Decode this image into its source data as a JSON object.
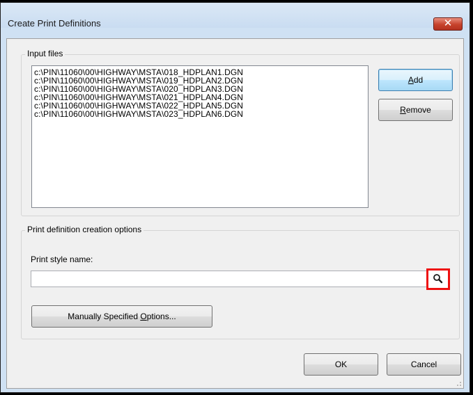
{
  "window": {
    "title": "Create Print Definitions",
    "close_glyph": "✕",
    "close_icon": "close-icon"
  },
  "input_files": {
    "group_label": "Input files",
    "files": [
      "c:\\PIN\\11060\\00\\HIGHWAY\\MSTA\\018_HDPLAN1.DGN",
      "c:\\PIN\\11060\\00\\HIGHWAY\\MSTA\\019_HDPLAN2.DGN",
      "c:\\PIN\\11060\\00\\HIGHWAY\\MSTA\\020_HDPLAN3.DGN",
      "c:\\PIN\\11060\\00\\HIGHWAY\\MSTA\\021_HDPLAN4.DGN",
      "c:\\PIN\\11060\\00\\HIGHWAY\\MSTA\\022_HDPLAN5.DGN",
      "c:\\PIN\\11060\\00\\HIGHWAY\\MSTA\\023_HDPLAN6.DGN"
    ],
    "add_label": {
      "pre": "",
      "key": "A",
      "post": "dd"
    },
    "remove_label": {
      "pre": "",
      "key": "R",
      "post": "emove"
    }
  },
  "options": {
    "group_label": "Print definition creation options",
    "style_name_label": "Print style name:",
    "style_name_value": "",
    "manual_label": {
      "pre": "Manually Specified ",
      "key": "O",
      "post": "ptions..."
    },
    "search_icon": "search-icon",
    "highlight_color": "#ee1010"
  },
  "footer": {
    "ok_label": "OK",
    "cancel_label": "Cancel"
  }
}
